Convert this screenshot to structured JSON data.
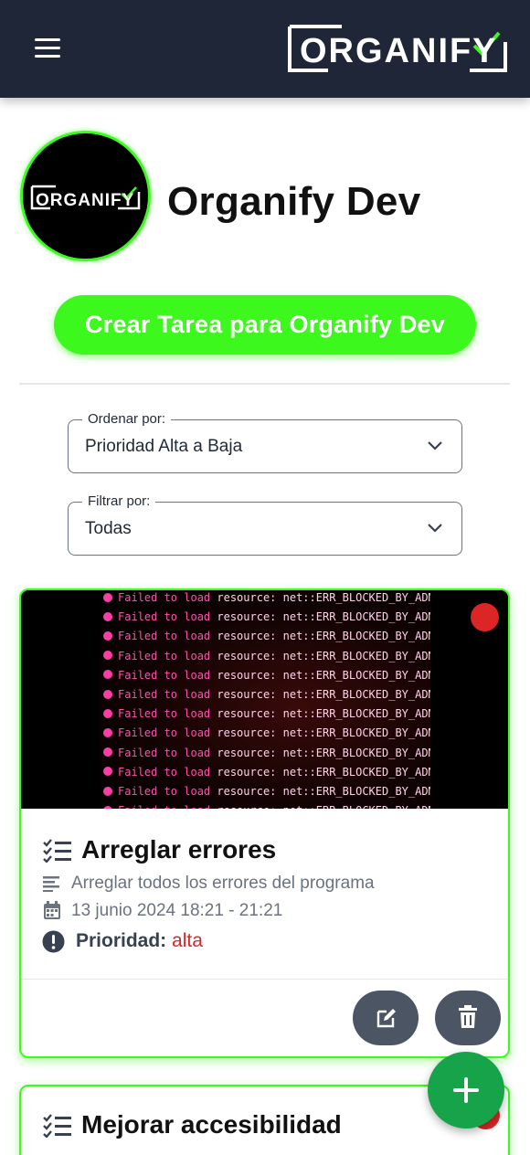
{
  "header": {
    "menu_icon": "hamburger-icon",
    "brand_logo_text": "ORGANIFY"
  },
  "profile": {
    "avatar_logo_text": "ORGANIFY",
    "name": "Organify Dev",
    "create_button_label": "Crear Tarea para Organify Dev"
  },
  "sort": {
    "legend": "Ordenar por:",
    "value": "Prioridad Alta a Baja"
  },
  "filter": {
    "legend": "Filtrar por:",
    "value": "Todas"
  },
  "tasks": [
    {
      "title": "Arreglar errores",
      "description": "Arreglar todos los errores del programa",
      "datetime": "13 junio 2024 18:21 - 21:21",
      "priority_label": "Prioridad:",
      "priority_value": "alta",
      "priority_color": "#dc2626",
      "image_console_lines": [
        "Failed to load resource: net::ERR_BLOCKED_BY_ADMINISTRATOR",
        "Failed to load resource: net::ERR_BLOCKED_BY_ADMINISTRATOR",
        "Failed to load resource: net::ERR_BLOCKED_BY_ADMINISTRATOR",
        "Failed to load resource: net::ERR_BLOCKED_BY_ADMINISTRATOR",
        "Failed to load resource: net::ERR_BLOCKED_BY_ADMINISTRATOR",
        "Failed to load resource: net::ERR_BLOCKED_BY_ADMINISTRATOR",
        "Failed to load resource: net::ERR_BLOCKED_BY_ADMINISTRATOR",
        "Failed to load resource: net::ERR_BLOCKED_BY_ADMINISTRATOR",
        "Failed to load resource: net::ERR_BLOCKED_BY_ADMINISTRATOR",
        "Failed to load resource: net::ERR_BLOCKED_BY_ADMINISTRATOR",
        "Failed to load resource: net::ERR_BLOCKED_BY_ADMINISTRATOR",
        "Failed to load resource: net::ERR_BLOCKED_BY_ADMINISTRATOR"
      ],
      "edit_icon": "edit-icon",
      "delete_icon": "trash-icon"
    },
    {
      "title": "Mejorar accesibilidad",
      "priority_color": "#dc2626"
    }
  ],
  "fab_icon": "plus-icon",
  "colors": {
    "header_bg": "#1e2638",
    "accent_green": "#3cf81c",
    "fab_green": "#16a34a",
    "priority_high": "#dc2626",
    "action_button": "#4b5563"
  }
}
